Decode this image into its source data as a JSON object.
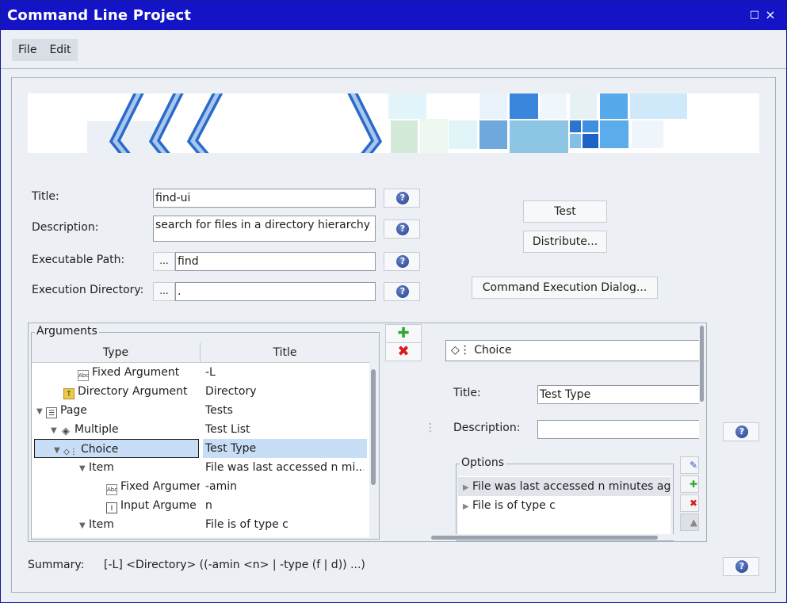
{
  "window": {
    "title": "Command Line Project",
    "maximize_glyph": "□",
    "close_glyph": "×"
  },
  "menu": {
    "items": [
      "File",
      "Edit"
    ]
  },
  "form": {
    "title_label": "Title:",
    "title_value": "find-ui",
    "description_label": "Description:",
    "description_value": "search for files in a directory hierarchy",
    "exec_path_label": "Executable Path:",
    "exec_path_value": "find",
    "exec_dir_label": "Execution Directory:",
    "exec_dir_value": ".",
    "browse_label": "...",
    "help_glyph": "?"
  },
  "actions": {
    "test": "Test",
    "distribute": "Distribute...",
    "exec_dialog": "Command Execution Dialog..."
  },
  "arguments": {
    "legend": "Arguments",
    "columns": [
      "Type",
      "Title"
    ],
    "rows": [
      {
        "type": "Fixed Argument",
        "title": "-L",
        "icon": "text-abc-icon",
        "expander": ""
      },
      {
        "type": "Directory Argument",
        "title": "Directory",
        "icon": "folder-up-icon",
        "expander": ""
      },
      {
        "type": "Page",
        "title": "Tests",
        "icon": "list-page-icon",
        "expander": "▼"
      },
      {
        "type": "Multiple",
        "title": "Test List",
        "icon": "layers-icon",
        "expander": "▼"
      },
      {
        "type": "Choice",
        "title": "Test Type",
        "icon": "choice-icon",
        "expander": "▼",
        "selected": true
      },
      {
        "type": "Item",
        "title": "File was last accessed n mi...",
        "icon": "",
        "expander": "▼"
      },
      {
        "type": "Fixed Argumer",
        "title": "-amin",
        "icon": "text-abc-icon",
        "expander": ""
      },
      {
        "type": "Input Argume",
        "title": "n",
        "icon": "input-field-icon",
        "expander": ""
      },
      {
        "type": "Item",
        "title": "File is of type c",
        "icon": "",
        "expander": "▼"
      }
    ],
    "add_glyph": "✚",
    "remove_glyph": "✖"
  },
  "details": {
    "header": "◇⋮ Choice",
    "title_label": "Title:",
    "title_value": "Test Type",
    "description_label": "Description:",
    "description_value": "",
    "drag_handle": "⋮",
    "options_legend": "Options",
    "options": [
      "File was last accessed n minutes ag",
      "File is of type c"
    ],
    "option_expander": "▶"
  },
  "summary": {
    "label": "Summary:",
    "value": "[-L] <Directory> ((-amin <n> | -type (f | d)) ...)"
  },
  "colors": {
    "titlebar": "#1414c6",
    "selection": "#c8ddf6",
    "accent": "#2a57c8"
  }
}
